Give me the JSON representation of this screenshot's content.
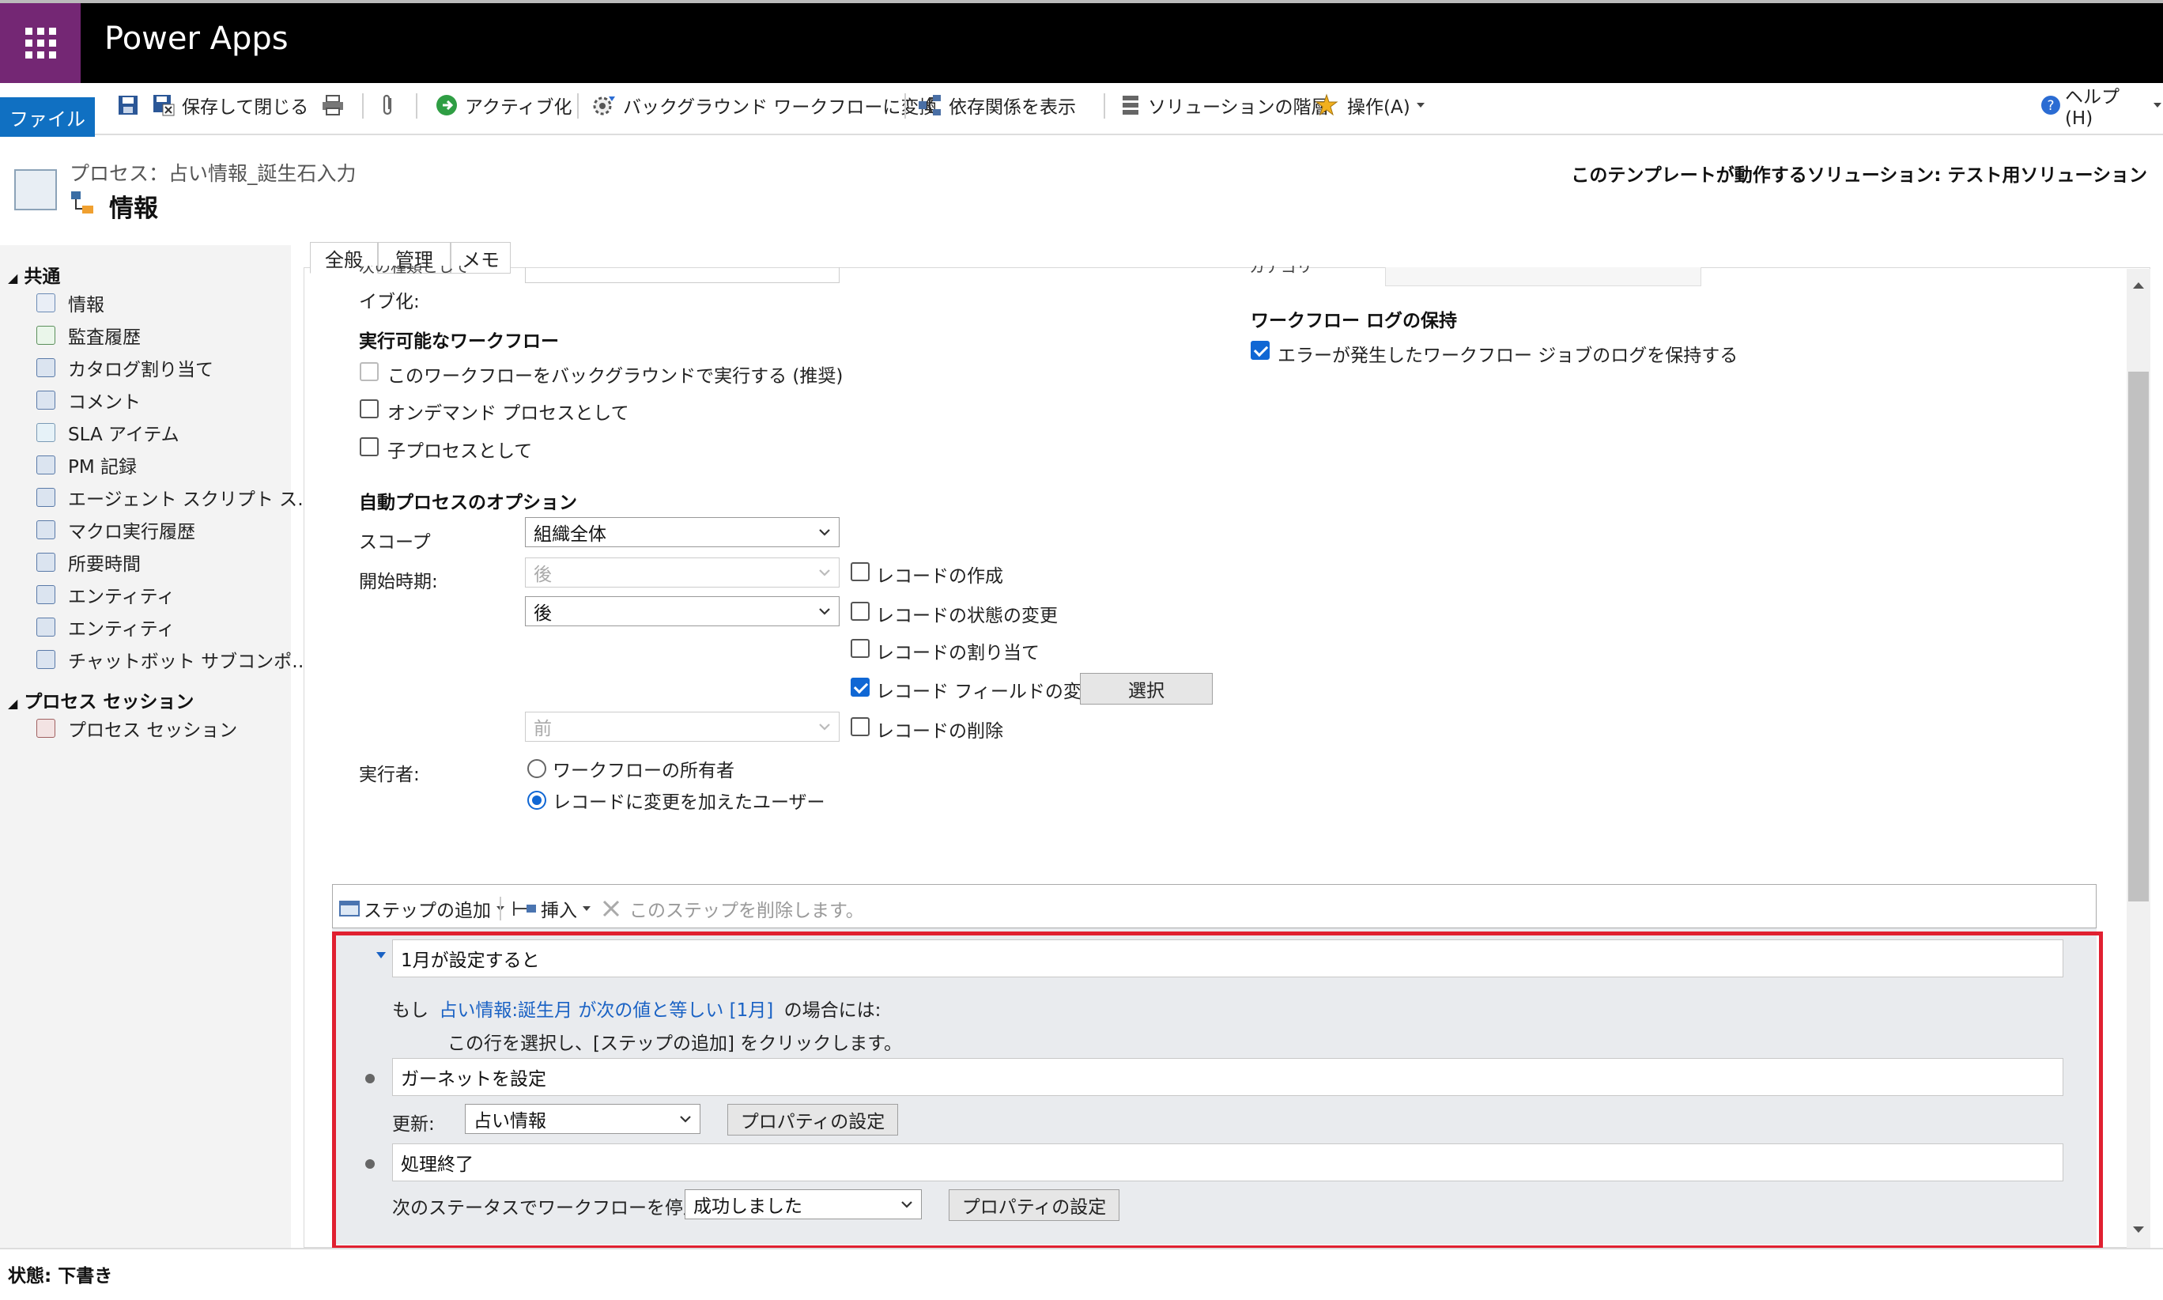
{
  "app": {
    "title": "Power Apps"
  },
  "ribbon": {
    "file_tab": "ファイル",
    "save_close": "保存して閉じる",
    "activate": "アクティブ化",
    "convert_bg": "バックグラウンド ワークフローに変換",
    "show_deps": "依存関係を表示",
    "solution_layers": "ソリューションの階層",
    "actions": "操作(A)",
    "help": "ヘルプ(H)"
  },
  "header": {
    "process_label": "プロセス：占い情報_誕生石入力",
    "page_title": "情報",
    "solution_text": "このテンプレートが動作するソリューション: テスト用ソリューション"
  },
  "sidebar": {
    "group_common": "共通",
    "items_common": [
      "情報",
      "監査履歴",
      "カタログ割り当て",
      "コメント",
      "SLA アイテム",
      "PM 記録",
      "エージェント スクリプト ス…",
      "マクロ実行履歴",
      "所要時間",
      "エンティティ",
      "エンティティ",
      "チャットボット サブコンポ…"
    ],
    "group_session": "プロセス セッション",
    "items_session": [
      "プロセス セッション"
    ]
  },
  "tabs": [
    "全般",
    "管理",
    "メモ"
  ],
  "form": {
    "cut_label_1": "次の種類として",
    "cut_label_2": "イブ化:",
    "cut_category": "カテゴリ",
    "exec_workflow_title": "実行可能なワークフロー",
    "bg_checkbox": "このワークフローをバックグラウンドで実行する (推奨)",
    "ondemand": "オンデマンド プロセスとして",
    "child": "子プロセスとして",
    "log_title": "ワークフロー ログの保持",
    "log_checkbox": "エラーが発生したワークフロー ジョブのログを保持する",
    "auto_title": "自動プロセスのオプション",
    "scope_label": "スコープ",
    "scope_value": "組織全体",
    "start_label": "開始時期:",
    "start_sel1": "後",
    "start_sel2": "後",
    "start_sel3": "前",
    "rec_create": "レコードの作成",
    "rec_status": "レコードの状態の変更",
    "rec_assign": "レコードの割り当て",
    "rec_field": "レコード フィールドの変更",
    "select_btn": "選択",
    "rec_delete": "レコードの削除",
    "runas_label": "実行者:",
    "runas_owner": "ワークフローの所有者",
    "runas_user": "レコードに変更を加えたユーザー"
  },
  "steps": {
    "add_step": "ステップの追加",
    "insert": "挿入",
    "delete_step": "このステップを削除します。",
    "condition_title": "1月が設定すると",
    "if_prefix": "もし",
    "if_link": "占い情報:誕生月 が次の値と等しい [1月]",
    "if_suffix": "の場合には:",
    "hint": "この行を選択し、[ステップの追加] をクリックします。",
    "step1_title": "ガーネットを設定",
    "update_label": "更新:",
    "update_entity": "占い情報",
    "prop_btn1": "プロパティの設定",
    "step2_title": "処理終了",
    "stop_label": "次のステータスでワークフローを停止:",
    "stop_value": "成功しました",
    "prop_btn2": "プロパティの設定"
  },
  "status": {
    "text": "状態: 下書き"
  },
  "colors": {
    "brand": "#742774",
    "accent": "#1067d4",
    "highlight": "#e02030"
  }
}
